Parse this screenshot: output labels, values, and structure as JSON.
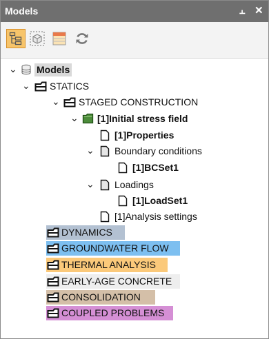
{
  "panel": {
    "title": "Models",
    "pin_glyph": "⫠",
    "close_glyph": "✕"
  },
  "toolbar": {
    "buttons": [
      {
        "icon": "tree-view-icon",
        "active": true
      },
      {
        "icon": "model-view-icon",
        "active": false
      },
      {
        "icon": "table-view-icon",
        "active": false
      },
      {
        "icon": "refresh-icon",
        "active": false
      }
    ]
  },
  "colors": {
    "dynamics": "#b3c1d2",
    "groundwater_flow": "#7dbff0",
    "thermal_analysis": "#fbc97a",
    "early_age_concrete": "#eeeeee",
    "consolidation": "#d4bfa8",
    "coupled_problems": "#d58fd5",
    "active_toolbar": "#f7c46a"
  },
  "tree": {
    "root": "Models",
    "statics": "STATICS",
    "staged_construction": "STAGED CONSTRUCTION",
    "initial_stress_field": "[1]Initial stress field",
    "properties": "[1]Properties",
    "boundary_conditions": "Boundary conditions",
    "bcset": "[1]BCSet1",
    "loadings": "Loadings",
    "loadset": "[1]LoadSet1",
    "analysis_settings": "[1]Analysis settings",
    "dynamics": "DYNAMICS",
    "groundwater_flow": "GROUNDWATER FLOW",
    "thermal_analysis": "THERMAL ANALYSIS",
    "early_age_concrete": "EARLY-AGE CONCRETE",
    "consolidation": "CONSOLIDATION",
    "coupled_problems": "COUPLED PROBLEMS"
  }
}
